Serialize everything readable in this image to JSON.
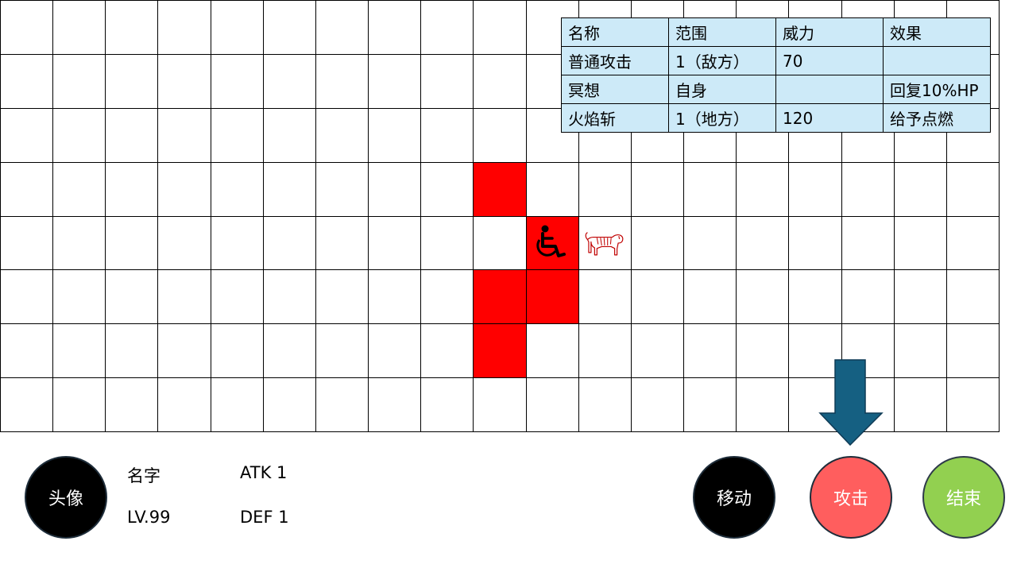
{
  "board": {
    "cols": 19,
    "rows": 8
  },
  "range_cells": [
    [
      9,
      3
    ],
    [
      10,
      4
    ],
    [
      10,
      5
    ],
    [
      9,
      5
    ],
    [
      9,
      6
    ]
  ],
  "player": {
    "icon": "wheelchair-icon",
    "cell": [
      10,
      4
    ]
  },
  "enemy": {
    "icon": "tiger-icon",
    "cell": [
      11,
      4
    ]
  },
  "skill_table": {
    "headers": [
      "名称",
      "范围",
      "威力",
      "效果"
    ],
    "rows": [
      [
        "普通攻击",
        "1（敌方）",
        "70",
        ""
      ],
      [
        "冥想",
        "自身",
        "",
        "回复10%HP"
      ],
      [
        "火焰斩",
        "1（地方）",
        "120",
        "给予点燃"
      ]
    ]
  },
  "character": {
    "avatar_label": "头像",
    "name_label": "名字",
    "level_label": "LV.99",
    "atk_label": "ATK 1",
    "def_label": "DEF 1"
  },
  "actions": {
    "move_label": "移动",
    "attack_label": "攻击",
    "end_label": "结束"
  },
  "colors": {
    "range": "#ff0000",
    "table_bg": "#cdeaf8",
    "attack": "#ff5e5e",
    "end": "#92d050",
    "arrow": "#156082"
  },
  "hint": {
    "icon": "down-arrow-icon",
    "target": "attack"
  }
}
